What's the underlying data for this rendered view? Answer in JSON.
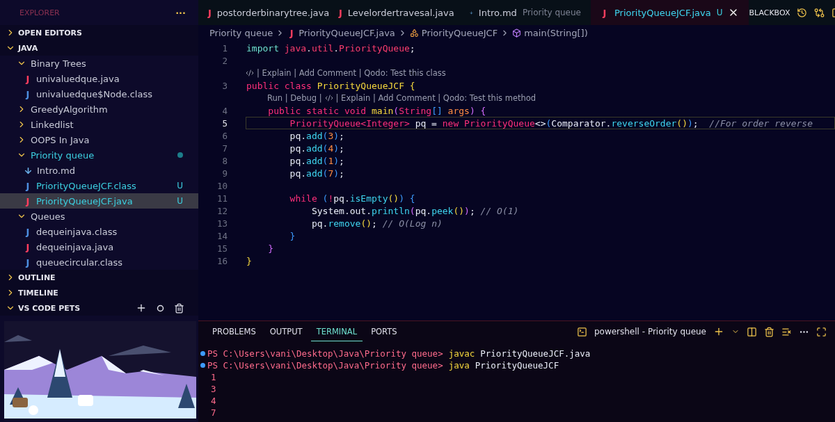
{
  "sidebar": {
    "title": "EXPLORER",
    "more": "···",
    "sections": [
      {
        "label": "OPEN EDITORS",
        "expanded": false
      },
      {
        "label": "JAVA",
        "expanded": true,
        "items": [
          {
            "label": "Binary Trees",
            "kind": "folder",
            "expanded": true,
            "untracked": false,
            "selected": false,
            "children": [
              {
                "label": "univaluedque.java",
                "kind": "java",
                "glyph": "J",
                "untracked": false,
                "selected": false
              },
              {
                "label": "univaluedque$Node.class",
                "kind": "class",
                "glyph": "J",
                "untracked": false,
                "selected": false
              }
            ]
          },
          {
            "label": "GreedyAlgorithm",
            "kind": "folder",
            "expanded": false,
            "untracked": false,
            "selected": false
          },
          {
            "label": "Linkedlist",
            "kind": "folder",
            "expanded": false,
            "untracked": false,
            "selected": false
          },
          {
            "label": "OOPS In Java",
            "kind": "folder",
            "expanded": false,
            "untracked": false,
            "selected": false
          },
          {
            "label": "Priority queue",
            "kind": "folder",
            "expanded": true,
            "untracked": true,
            "selected": false,
            "children": [
              {
                "label": "Intro.md",
                "kind": "md",
                "untracked": false,
                "selected": false
              },
              {
                "label": "PriorityQueueJCF.class",
                "kind": "class",
                "glyph": "J",
                "untracked": true,
                "badge": "U",
                "selected": false
              },
              {
                "label": "PriorityQueueJCF.java",
                "kind": "java",
                "glyph": "J",
                "untracked": true,
                "badge": "U",
                "selected": true
              }
            ]
          },
          {
            "label": "Queues",
            "kind": "folder",
            "expanded": true,
            "untracked": false,
            "selected": false,
            "children": [
              {
                "label": "dequeinjava.class",
                "kind": "class",
                "glyph": "J",
                "untracked": false,
                "selected": false
              },
              {
                "label": "dequeinjava.java",
                "kind": "java",
                "glyph": "J",
                "untracked": false,
                "selected": false
              },
              {
                "label": "queuecircular.class",
                "kind": "class",
                "glyph": "J",
                "untracked": false,
                "selected": false
              }
            ]
          }
        ]
      },
      {
        "label": "OUTLINE",
        "expanded": false
      },
      {
        "label": "TIMELINE",
        "expanded": false
      },
      {
        "label": "VS CODE PETS",
        "expanded": true,
        "actions": true
      }
    ]
  },
  "tabs": [
    {
      "label": "postorderbinarytree.java",
      "kind": "java",
      "glyph": "J",
      "selected": false
    },
    {
      "label": "Levelordertravesal.java",
      "kind": "java",
      "glyph": "J",
      "selected": false
    },
    {
      "label": "Intro.md",
      "description": "Priority queue",
      "kind": "md",
      "selected": false
    },
    {
      "label": "PriorityQueueJCF.java",
      "badge": "U",
      "kind": "java",
      "glyph": "J",
      "selected": true
    }
  ],
  "toolbar": {
    "label": "BLACKBOX"
  },
  "breadcrumbs": [
    {
      "label": "Priority queue",
      "kind": "folder"
    },
    {
      "label": "PriorityQueueJCF.java",
      "kind": "java",
      "glyph": "J"
    },
    {
      "label": "PriorityQueueJCF",
      "kind": "class"
    },
    {
      "label": "main(String[])",
      "kind": "method"
    }
  ],
  "code": [
    {
      "kind": "line",
      "number": "1",
      "active": false,
      "tokens": [
        {
          "text": "import ",
          "kind": "imp"
        },
        {
          "text": "java",
          "kind": "red"
        },
        {
          "text": ".",
          "kind": "plain"
        },
        {
          "text": "util",
          "kind": "red"
        },
        {
          "text": ".",
          "kind": "plain"
        },
        {
          "text": "PriorityQueue",
          "kind": "red"
        },
        {
          "text": ";",
          "kind": "plain"
        }
      ]
    },
    {
      "kind": "line",
      "number": "2",
      "active": false
    },
    {
      "kind": "class_lens",
      "text": "| Explain | Add Comment | Qodo: Test this class"
    },
    {
      "kind": "line",
      "number": "3",
      "active": false,
      "tokens": [
        {
          "text": "public class ",
          "kind": "kw"
        },
        {
          "text": "PriorityQueueJCF ",
          "kind": "cls"
        },
        {
          "text": "{",
          "kind": "b1"
        }
      ]
    },
    {
      "kind": "method_lens",
      "prefix": "Run | Debug |",
      "text": "| Explain | Add Comment | Qodo: Test this method"
    },
    {
      "kind": "line",
      "number": "4",
      "active": false,
      "tokens": [
        {
          "text": "    public static void ",
          "kind": "kw"
        },
        {
          "text": "main",
          "kind": "cls"
        },
        {
          "text": "(",
          "kind": "b2"
        },
        {
          "text": "String",
          "kind": "kw"
        },
        {
          "text": "[] ",
          "kind": "b3"
        },
        {
          "text": "args",
          "kind": "param"
        },
        {
          "text": ") ",
          "kind": "b2"
        },
        {
          "text": "{",
          "kind": "b2"
        }
      ]
    },
    {
      "kind": "line",
      "number": "5",
      "active": true,
      "tokens": [
        {
          "text": "        PriorityQueue<Integer> ",
          "kind": "kw"
        },
        {
          "text": "pq = ",
          "kind": "plain"
        },
        {
          "text": "new PriorityQueue",
          "kind": "kw"
        },
        {
          "text": "<>",
          "kind": "plain"
        },
        {
          "text": "(",
          "kind": "b3"
        },
        {
          "text": "Comparator.",
          "kind": "plain"
        },
        {
          "text": "reverseOrder",
          "kind": "fn"
        },
        {
          "text": "()",
          "kind": "b1"
        },
        {
          "text": ")",
          "kind": "b3"
        },
        {
          "text": ";  ",
          "kind": "plain"
        },
        {
          "text": "//For order reverse",
          "kind": "comment"
        }
      ]
    },
    {
      "kind": "line",
      "number": "6",
      "active": false,
      "tokens": [
        {
          "text": "        pq.",
          "kind": "plain"
        },
        {
          "text": "add",
          "kind": "fn"
        },
        {
          "text": "(",
          "kind": "b3"
        },
        {
          "text": "3",
          "kind": "num"
        },
        {
          "text": ")",
          "kind": "b3"
        },
        {
          "text": ";",
          "kind": "plain"
        }
      ]
    },
    {
      "kind": "line",
      "number": "7",
      "active": false,
      "tokens": [
        {
          "text": "        pq.",
          "kind": "plain"
        },
        {
          "text": "add",
          "kind": "fn"
        },
        {
          "text": "(",
          "kind": "b3"
        },
        {
          "text": "4",
          "kind": "num"
        },
        {
          "text": ")",
          "kind": "b3"
        },
        {
          "text": ";",
          "kind": "plain"
        }
      ]
    },
    {
      "kind": "line",
      "number": "8",
      "active": false,
      "tokens": [
        {
          "text": "        pq.",
          "kind": "plain"
        },
        {
          "text": "add",
          "kind": "fn"
        },
        {
          "text": "(",
          "kind": "b3"
        },
        {
          "text": "1",
          "kind": "num"
        },
        {
          "text": ")",
          "kind": "b3"
        },
        {
          "text": ";",
          "kind": "plain"
        }
      ]
    },
    {
      "kind": "line",
      "number": "9",
      "active": false,
      "tokens": [
        {
          "text": "        pq.",
          "kind": "plain"
        },
        {
          "text": "add",
          "kind": "fn"
        },
        {
          "text": "(",
          "kind": "b3"
        },
        {
          "text": "7",
          "kind": "num"
        },
        {
          "text": ")",
          "kind": "b3"
        },
        {
          "text": ";",
          "kind": "plain"
        }
      ]
    },
    {
      "kind": "line",
      "number": "10",
      "active": false
    },
    {
      "kind": "line",
      "number": "11",
      "active": false,
      "tokens": [
        {
          "text": "        while ",
          "kind": "kw"
        },
        {
          "text": "(",
          "kind": "b3"
        },
        {
          "text": "!",
          "kind": "kw"
        },
        {
          "text": "pq.",
          "kind": "plain"
        },
        {
          "text": "isEmpty",
          "kind": "fn"
        },
        {
          "text": "()",
          "kind": "b1"
        },
        {
          "text": ") ",
          "kind": "b3"
        },
        {
          "text": "{",
          "kind": "b3"
        }
      ]
    },
    {
      "kind": "line",
      "number": "12",
      "active": false,
      "tokens": [
        {
          "text": "            System.out.",
          "kind": "plain"
        },
        {
          "text": "println",
          "kind": "fn"
        },
        {
          "text": "(",
          "kind": "b2"
        },
        {
          "text": "pq.",
          "kind": "plain"
        },
        {
          "text": "peek",
          "kind": "fn"
        },
        {
          "text": "()",
          "kind": "b1"
        },
        {
          "text": ")",
          "kind": "b2"
        },
        {
          "text": "; ",
          "kind": "plain"
        },
        {
          "text": "// O(1)",
          "kind": "comment"
        }
      ]
    },
    {
      "kind": "line",
      "number": "13",
      "active": false,
      "tokens": [
        {
          "text": "            pq.",
          "kind": "plain"
        },
        {
          "text": "remove",
          "kind": "fn"
        },
        {
          "text": "()",
          "kind": "b1"
        },
        {
          "text": "; ",
          "kind": "plain"
        },
        {
          "text": "// O(Log n)",
          "kind": "comment"
        }
      ]
    },
    {
      "kind": "line",
      "number": "14",
      "active": false,
      "tokens": [
        {
          "text": "        }",
          "kind": "b3"
        }
      ]
    },
    {
      "kind": "line",
      "number": "15",
      "active": false,
      "tokens": [
        {
          "text": "    }",
          "kind": "b2"
        }
      ]
    },
    {
      "kind": "line",
      "number": "16",
      "active": false,
      "tokens": [
        {
          "text": "}",
          "kind": "b1"
        }
      ]
    }
  ],
  "panel": {
    "tabs": [
      {
        "label": "PROBLEMS",
        "selected": false
      },
      {
        "label": "OUTPUT",
        "selected": false
      },
      {
        "label": "TERMINAL",
        "selected": true
      },
      {
        "label": "PORTS",
        "selected": false
      }
    ],
    "terminal_name": "powershell - Priority queue",
    "lines": [
      {
        "kind": "command",
        "prompt": "PS C:\\Users\\vani\\Desktop\\Java\\Priority queue>",
        "command": "javac",
        "args": "PriorityQueueJCF.java"
      },
      {
        "kind": "command",
        "prompt": "PS C:\\Users\\vani\\Desktop\\Java\\Priority queue>",
        "command": "java",
        "args": "PriorityQueueJCF"
      },
      {
        "kind": "output",
        "text": "1"
      },
      {
        "kind": "output",
        "text": "3"
      },
      {
        "kind": "output",
        "text": "4"
      },
      {
        "kind": "output",
        "text": "7"
      }
    ]
  }
}
